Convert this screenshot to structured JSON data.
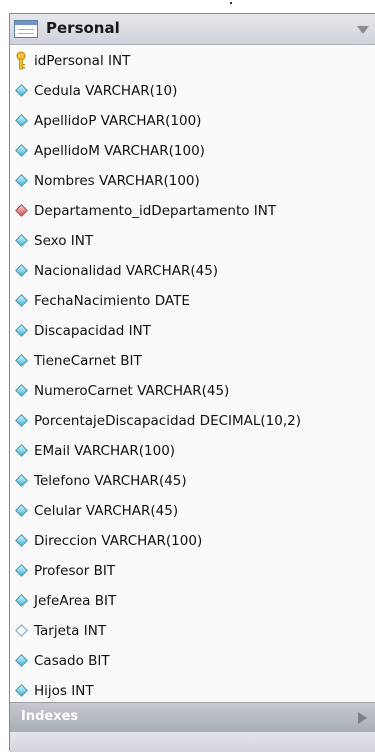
{
  "table": {
    "title": "Personal",
    "icon": "table-icon",
    "columns": [
      {
        "label": "idPersonal INT",
        "icon": "primary-key-icon"
      },
      {
        "label": "Cedula VARCHAR(10)",
        "icon": "not-null-column-icon"
      },
      {
        "label": "ApellidoP VARCHAR(100)",
        "icon": "not-null-column-icon"
      },
      {
        "label": "ApellidoM VARCHAR(100)",
        "icon": "not-null-column-icon"
      },
      {
        "label": "Nombres VARCHAR(100)",
        "icon": "not-null-column-icon"
      },
      {
        "label": "Departamento_idDepartamento INT",
        "icon": "foreign-key-icon"
      },
      {
        "label": "Sexo INT",
        "icon": "not-null-column-icon"
      },
      {
        "label": "Nacionalidad VARCHAR(45)",
        "icon": "not-null-column-icon"
      },
      {
        "label": "FechaNacimiento DATE",
        "icon": "not-null-column-icon"
      },
      {
        "label": "Discapacidad INT",
        "icon": "not-null-column-icon"
      },
      {
        "label": "TieneCarnet BIT",
        "icon": "not-null-column-icon"
      },
      {
        "label": "NumeroCarnet VARCHAR(45)",
        "icon": "not-null-column-icon"
      },
      {
        "label": "PorcentajeDiscapacidad DECIMAL(10,2)",
        "icon": "not-null-column-icon"
      },
      {
        "label": "EMail VARCHAR(100)",
        "icon": "not-null-column-icon"
      },
      {
        "label": "Telefono VARCHAR(45)",
        "icon": "not-null-column-icon"
      },
      {
        "label": "Celular VARCHAR(45)",
        "icon": "not-null-column-icon"
      },
      {
        "label": "Direccion VARCHAR(100)",
        "icon": "not-null-column-icon"
      },
      {
        "label": "Profesor BIT",
        "icon": "not-null-column-icon"
      },
      {
        "label": "JefeArea BIT",
        "icon": "not-null-column-icon"
      },
      {
        "label": "Tarjeta INT",
        "icon": "nullable-column-icon"
      },
      {
        "label": "Casado BIT",
        "icon": "not-null-column-icon"
      },
      {
        "label": "Hijos INT",
        "icon": "not-null-column-icon"
      }
    ],
    "indexes_label": "Indexes"
  },
  "colors": {
    "header": "#d9dce1",
    "indexes_bar": "#b8bbc1",
    "not_null_icon": "#46b6d6",
    "foreign_key_icon": "#d94b4b",
    "primary_key_icon": "#e8b620"
  }
}
